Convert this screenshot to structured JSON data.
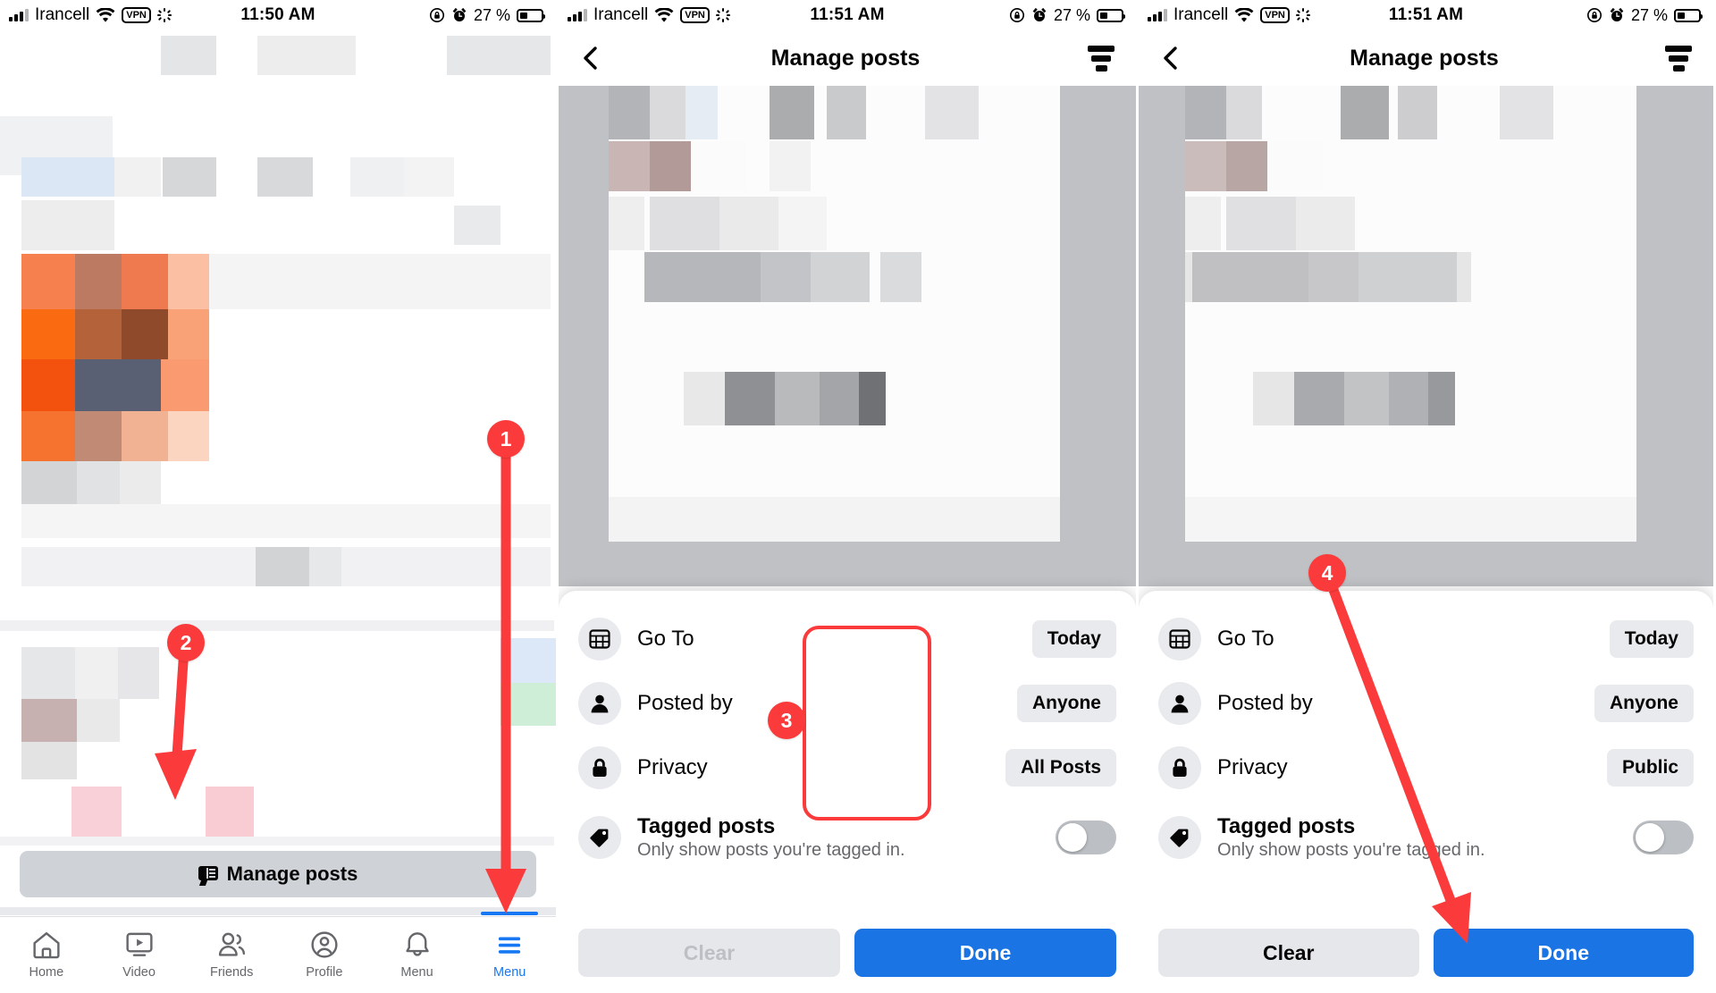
{
  "status_bar": {
    "carrier": "Irancell",
    "vpn_label": "VPN",
    "time_panel1": "11:50 AM",
    "time_panel2": "11:51 AM",
    "time_panel3": "11:51 AM",
    "battery_percent": "27 %",
    "icons": [
      "signal-bars-icon",
      "wifi-icon",
      "vpn-badge-icon",
      "sync-spinner-icon",
      "rotation-lock-icon",
      "alarm-clock-icon",
      "battery-icon"
    ]
  },
  "panel1": {
    "manage_posts_label": "Manage posts",
    "tabs": [
      {
        "label": "Home",
        "icon": "home-icon",
        "active": false
      },
      {
        "label": "Video",
        "icon": "video-icon",
        "active": false
      },
      {
        "label": "Friends",
        "icon": "friends-icon",
        "active": false
      },
      {
        "label": "Profile",
        "icon": "profile-icon",
        "active": false
      },
      {
        "label": "Menu",
        "icon": "hamburger-menu-icon",
        "active": true
      }
    ]
  },
  "panel2": {
    "title": "Manage posts",
    "back_icon": "chevron-left-icon",
    "filter_icon": "filter-funnel-icon",
    "filters": [
      {
        "icon": "calendar-icon",
        "label": "Go To",
        "value": "Today"
      },
      {
        "icon": "person-icon",
        "label": "Posted by",
        "value": "Anyone"
      },
      {
        "icon": "lock-icon",
        "label": "Privacy",
        "value": "All Posts"
      }
    ],
    "tagged": {
      "icon": "tag-icon",
      "title": "Tagged posts",
      "subtitle": "Only show posts you're tagged in.",
      "enabled": false
    },
    "clear_label": "Clear",
    "done_label": "Done",
    "clear_enabled": false
  },
  "panel3": {
    "title": "Manage posts",
    "back_icon": "chevron-left-icon",
    "filter_icon": "filter-funnel-icon",
    "filters": [
      {
        "icon": "calendar-icon",
        "label": "Go To",
        "value": "Today"
      },
      {
        "icon": "person-icon",
        "label": "Posted by",
        "value": "Anyone"
      },
      {
        "icon": "lock-icon",
        "label": "Privacy",
        "value": "Public"
      }
    ],
    "tagged": {
      "icon": "tag-icon",
      "title": "Tagged posts",
      "subtitle": "Only show posts you're tagged in.",
      "enabled": false
    },
    "clear_label": "Clear",
    "done_label": "Done",
    "clear_enabled": true
  },
  "annotations": {
    "step1": "1",
    "step2": "2",
    "step3": "3",
    "step4": "4",
    "color": "#fb3b3b"
  }
}
